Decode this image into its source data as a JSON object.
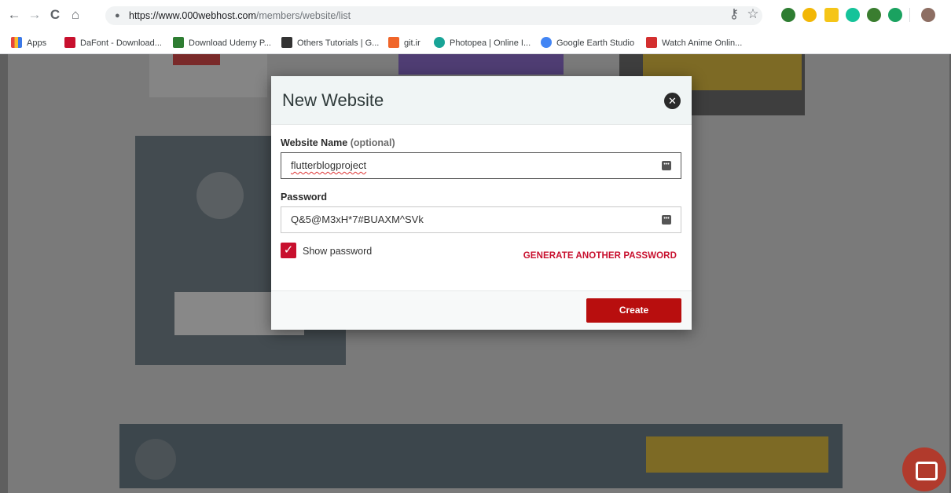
{
  "browser": {
    "url_host": "https://www.000webhost.com",
    "url_path": "/members/website/list"
  },
  "bookmarks": [
    {
      "label": "Apps",
      "color": "#e8453c"
    },
    {
      "label": "DaFont - Download...",
      "color": "#c8102e"
    },
    {
      "label": "Download Udemy P...",
      "color": "#2e7d32"
    },
    {
      "label": "Others Tutorials | G...",
      "color": "#333333"
    },
    {
      "label": "git.ir",
      "color": "#f06529"
    },
    {
      "label": "Photopea | Online I...",
      "color": "#18a497"
    },
    {
      "label": "Google Earth Studio",
      "color": "#4285f4"
    },
    {
      "label": "Watch Anime Onlin...",
      "color": "#d32f2f"
    }
  ],
  "modal": {
    "title": "New Website",
    "name_label": "Website Name",
    "name_optional": "(optional)",
    "name_value": "flutterblogproject",
    "password_label": "Password",
    "password_value": "Q&5@M3xH*7#BUAXM^SVk",
    "show_password_label": "Show password",
    "show_password_checked": true,
    "generate_label": "GENERATE ANOTHER PASSWORD",
    "create_label": "Create"
  },
  "colors": {
    "accent": "#c8102e",
    "create_button": "#b80e0e"
  },
  "icons": {
    "back": "←",
    "forward": "→",
    "reload": "C",
    "home": "⌂",
    "star": "☆",
    "key": "⚷",
    "close": "✕",
    "check": "✓"
  }
}
